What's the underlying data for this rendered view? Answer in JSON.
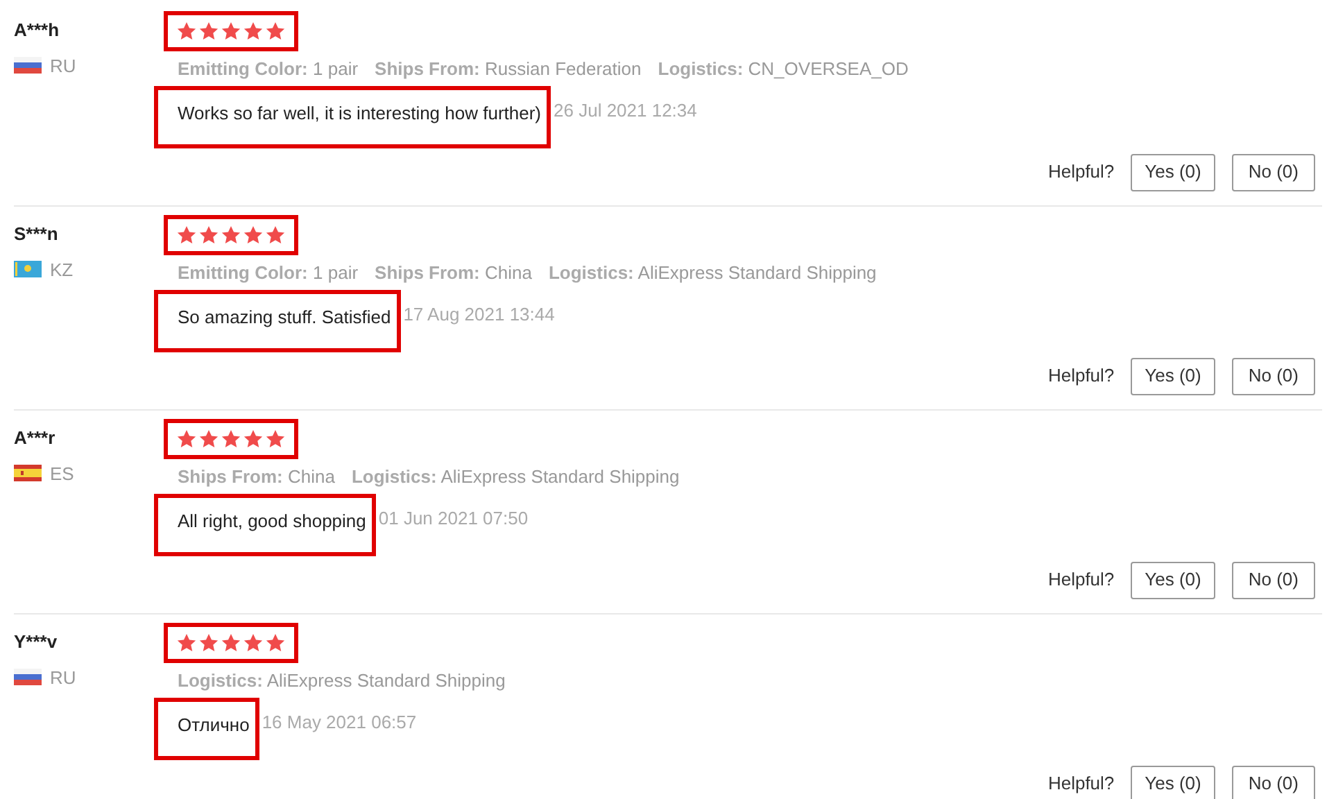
{
  "reviews": [
    {
      "name": "A***h",
      "kind": "ru",
      "country": "RU",
      "stars": 5,
      "stars_highlighted": true,
      "attributes": [
        {
          "label": "Emitting Color:",
          "value": "1 pair"
        },
        {
          "label": "Ships From:",
          "value": "Russian Federation"
        },
        {
          "label": "Logistics:",
          "value": "CN_OVERSEA_OD"
        }
      ],
      "comment": "Works so far well, it is interesting how further)",
      "comment_highlighted": true,
      "date": "26 Jul 2021 12:34",
      "helpful_label": "Helpful?",
      "yes": "Yes (0)",
      "no": "No (0)"
    },
    {
      "name": "S***n",
      "kind": "kz",
      "country": "KZ",
      "stars": 5,
      "stars_highlighted": true,
      "attributes": [
        {
          "label": "Emitting Color:",
          "value": "1 pair"
        },
        {
          "label": "Ships From:",
          "value": "China"
        },
        {
          "label": "Logistics:",
          "value": "AliExpress Standard Shipping"
        }
      ],
      "comment": "So amazing stuff. Satisfied",
      "comment_highlighted": true,
      "date": "17 Aug 2021 13:44",
      "helpful_label": "Helpful?",
      "yes": "Yes (0)",
      "no": "No (0)"
    },
    {
      "name": "A***r",
      "kind": "es",
      "country": "ES",
      "stars": 5,
      "stars_highlighted": true,
      "attributes": [
        {
          "label": "Ships From:",
          "value": "China"
        },
        {
          "label": "Logistics:",
          "value": "AliExpress Standard Shipping"
        }
      ],
      "comment": "All right, good shopping",
      "comment_highlighted": true,
      "date": "01 Jun 2021 07:50",
      "helpful_label": "Helpful?",
      "yes": "Yes (0)",
      "no": "No (0)"
    },
    {
      "name": "Y***v",
      "kind": "ru",
      "country": "RU",
      "stars": 5,
      "stars_highlighted": true,
      "attributes": [
        {
          "label": "Logistics:",
          "value": "AliExpress Standard Shipping"
        }
      ],
      "comment": "Отлично",
      "comment_highlighted": true,
      "date": "16 May 2021 06:57",
      "helpful_label": "Helpful?",
      "yes": "Yes (0)",
      "no": "No (0)"
    }
  ]
}
